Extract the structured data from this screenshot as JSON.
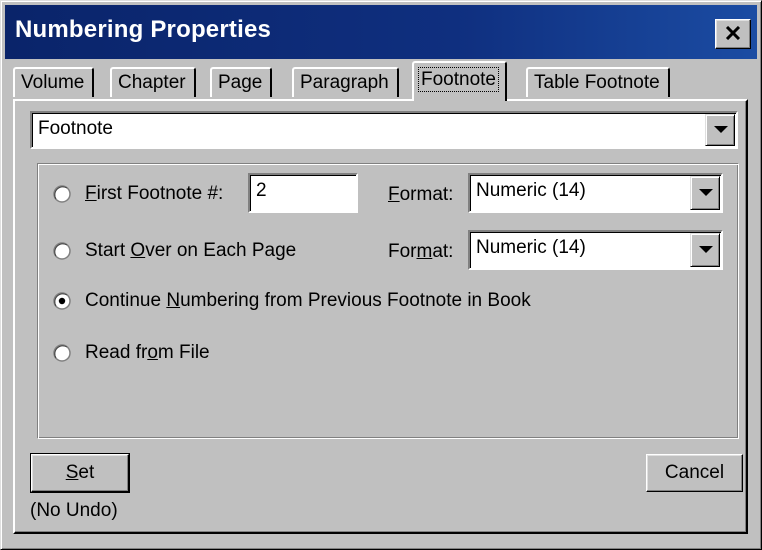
{
  "window": {
    "title": "Numbering Properties",
    "close_icon": "close-icon"
  },
  "tabs": [
    {
      "label": "Volume"
    },
    {
      "label": "Chapter"
    },
    {
      "label": "Page"
    },
    {
      "label": "Paragraph"
    },
    {
      "label": "Footnote",
      "active": true
    },
    {
      "label": "Table Footnote"
    }
  ],
  "type_select": {
    "value": "Footnote"
  },
  "options": {
    "first_footnote": {
      "label_pre": "",
      "label_u": "F",
      "label_post": "irst Footnote #:",
      "value": "2",
      "format_label_pre": "",
      "format_label_u": "F",
      "format_label_post": "ormat:",
      "format_value": "Numeric  (14)",
      "selected": false
    },
    "start_over": {
      "label_pre": "Start ",
      "label_u": "O",
      "label_post": "ver on Each Page",
      "format_label_pre": "For",
      "format_label_u": "m",
      "format_label_post": "at:",
      "format_value": "Numeric  (14)",
      "selected": false
    },
    "continue": {
      "label_pre": "Continue ",
      "label_u": "N",
      "label_post": "umbering from Previous Footnote in Book",
      "selected": true
    },
    "read_file": {
      "label_pre": "Read fr",
      "label_u": "o",
      "label_post": "m File",
      "selected": false
    }
  },
  "buttons": {
    "set_u": "S",
    "set_post": "et",
    "set_note": "(No Undo)",
    "cancel": "Cancel"
  },
  "colors": {
    "titlebar": "#0a246a",
    "face": "#c0c0c0"
  }
}
